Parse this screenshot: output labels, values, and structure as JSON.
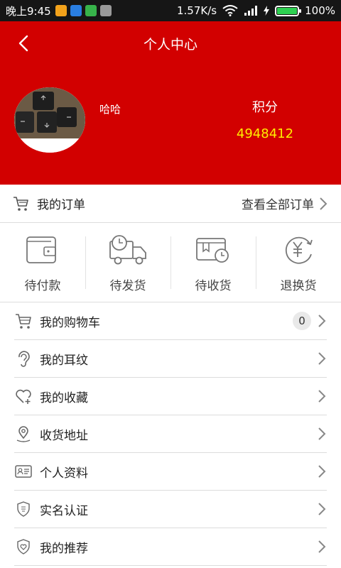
{
  "status_bar": {
    "time": "晚上9:45",
    "speed": "1.57K/s",
    "battery": "100%",
    "battery_level": 1.0
  },
  "header": {
    "title": "个人中心",
    "username": "哈哈",
    "points_label": "积分",
    "points_value": "4948412"
  },
  "orders": {
    "label": "我的订单",
    "view_all": "查看全部订单"
  },
  "order_status": [
    {
      "label": "待付款",
      "icon": "wallet-icon"
    },
    {
      "label": "待发货",
      "icon": "truck-clock-icon"
    },
    {
      "label": "待收货",
      "icon": "package-clock-icon"
    },
    {
      "label": "退换货",
      "icon": "yuan-return-icon"
    }
  ],
  "menu": [
    {
      "label": "我的购物车",
      "icon": "cart-icon",
      "badge": "0"
    },
    {
      "label": "我的耳纹",
      "icon": "ear-icon"
    },
    {
      "label": "我的收藏",
      "icon": "heart-plus-icon"
    },
    {
      "label": "收货地址",
      "icon": "location-pin-icon"
    },
    {
      "label": "个人资料",
      "icon": "id-card-icon"
    },
    {
      "label": "实名认证",
      "icon": "shield-verify-icon"
    },
    {
      "label": "我的推荐",
      "icon": "shield-heart-icon"
    }
  ],
  "colors": {
    "header_bg": "#d20000",
    "points_value": "#ffef00",
    "battery_green": "#2ed151"
  }
}
